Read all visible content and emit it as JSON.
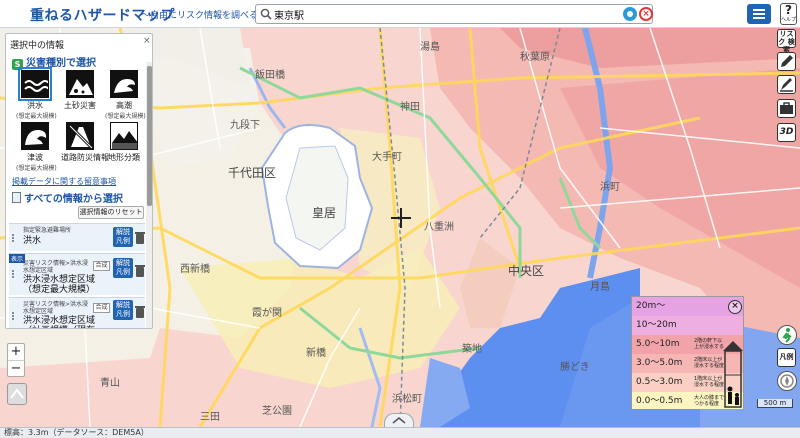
{
  "header": {
    "title": "重ねるハザードマップ",
    "subtitle": "～自由にリスク情報を調べる～",
    "search_value": "東京駅",
    "help_label": "?",
    "help_sub": "ヘルプ"
  },
  "panel": {
    "title": "選択中の情報",
    "close": "×",
    "hazard_section": "災害種別で選択",
    "hazards": [
      {
        "label": "洪水",
        "sub": "(想定最大規模)",
        "icon": "flood-icon"
      },
      {
        "label": "土砂災害",
        "sub": "",
        "icon": "landslide-icon"
      },
      {
        "label": "高潮",
        "sub": "(想定最大規模)",
        "icon": "storm-surge-icon"
      },
      {
        "label": "津波",
        "sub": "(想定最大規模)",
        "icon": "tsunami-icon"
      },
      {
        "label": "道路防災情報",
        "sub": "",
        "icon": "road-disaster-icon"
      },
      {
        "label": "地形分類",
        "sub": "",
        "icon": "landform-icon"
      }
    ],
    "notice_link": "掲載データに関する留意事項",
    "all_section": "すべての情報から選択",
    "reset_button": "選択情報のリセット",
    "layers": [
      {
        "small": "指定緊急避難場所",
        "name": "洪水",
        "tag": "",
        "merge": "",
        "legend": "解説 凡例"
      },
      {
        "small": "災害リスク情報>洪水浸 水想定区域",
        "name": "洪水浸水想定区域 （想定最大規模）",
        "tag": "表示",
        "merge": "合成",
        "legend": "解説 凡例"
      },
      {
        "small": "災害リスク情報>洪水浸 水想定区域",
        "name": "洪水浸水想定区域 （計画規模（現在の",
        "tag": "",
        "merge": "合成",
        "legend": "解説 凡例"
      }
    ]
  },
  "toolbar": {
    "risk": "リスク 検索",
    "tool_3d": "3D"
  },
  "zoom": {
    "in": "+",
    "out": "−"
  },
  "map_labels": {
    "chiyoda": "千代田区",
    "kokyo": "皇居",
    "chuo": "中央区",
    "iidabashi": "飯田橋",
    "yushima": "湯島",
    "shinbashi": "新橋",
    "tsukiji": "築地",
    "shiba": "芝公園",
    "kasumigaseki": "霞が関",
    "kudanshita": "九段下",
    "otemachi": "大手町",
    "yaesu": "八重洲",
    "hamacho": "浜町",
    "kachidoki": "勝どき",
    "toyosu": "豊洲",
    "tsukishima": "月島",
    "hamamatsucho": "浜松町",
    "nishi": "西新橋",
    "kanda": "神田",
    "akihabara": "秋葉原",
    "aoyama": "青山",
    "mita": "三田"
  },
  "legend": {
    "close": "×",
    "rows": [
      {
        "label": "20m～",
        "caption": "",
        "color": "#e6a3e3"
      },
      {
        "label": "10～20m",
        "caption": "",
        "color": "#eeaee0"
      },
      {
        "label": "5.0～10m",
        "caption": "2階の軒下以上が浸水する",
        "color": "#f2a3aa"
      },
      {
        "label": "3.0～5.0m",
        "caption": "2階床以上が浸水する程度",
        "color": "#f6b7b4"
      },
      {
        "label": "0.5～3.0m",
        "caption": "1階床以上が浸水する程度",
        "color": "#fbd0c4"
      },
      {
        "label": "0.0～0.5m",
        "caption": "大人の膝までつかる程度",
        "color": "#fbf5c1"
      }
    ]
  },
  "right_tools": {
    "legend_toggle": "凡例"
  },
  "scale": "500 m",
  "status": "標高：3.3m（データソース：DEM5A）"
}
